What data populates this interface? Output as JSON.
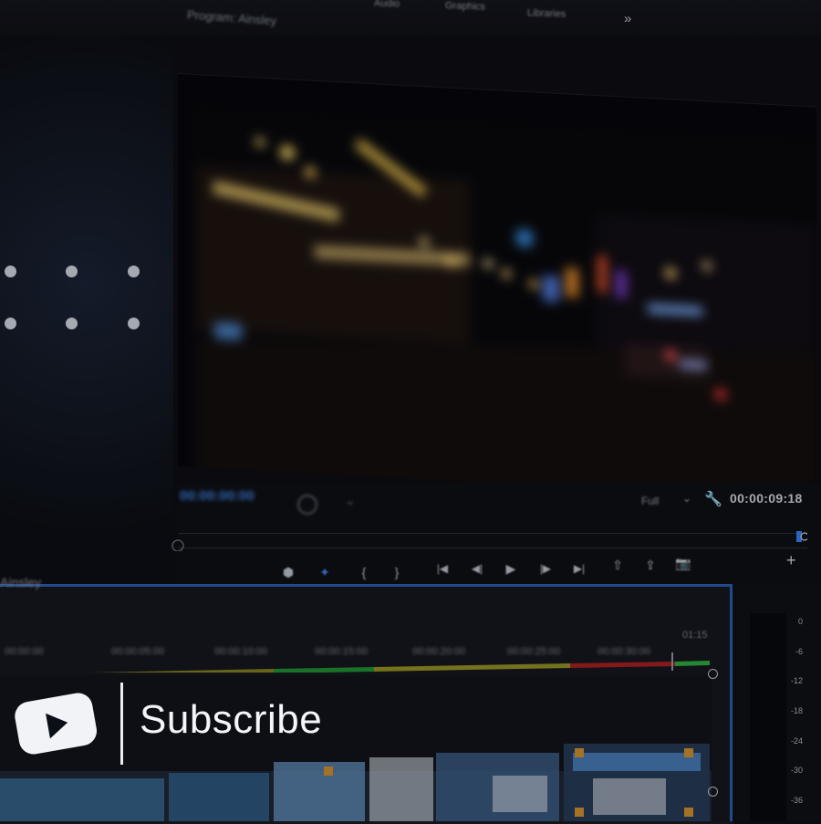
{
  "window": {
    "top_tabs": [
      "",
      "Audio",
      "Graphics",
      "Libraries"
    ],
    "more_tabs_icon": "double-chevron-right-icon",
    "panel_title": "Program: Ainsley"
  },
  "monitor": {
    "current_time_left": "00:00:00:00",
    "fit": "Full",
    "duration": "00:00:09:18"
  },
  "transport_icons": [
    "marker-icon",
    "ripple-icon",
    "mark-in-icon",
    "mark-out-icon",
    "go-to-in-icon",
    "step-back-icon",
    "play-icon",
    "step-forward-icon",
    "go-to-out-icon",
    "lift-icon",
    "extract-icon",
    "camera-icon"
  ],
  "add_button": "+",
  "timeline": {
    "sequence_name": "Ainsley",
    "ruler": [
      "00:00:00",
      "00:00:05:00",
      "00:00:10:00",
      "00:00:15:00",
      "00:00:20:00",
      "00:00:25:00",
      "00:00:30:00",
      "01:15"
    ]
  },
  "meter_labels": [
    "0",
    "-6",
    "-12",
    "-18",
    "-24",
    "-30",
    "-36"
  ],
  "overlay": {
    "subscribe_label": "Subscribe"
  },
  "colors": {
    "accent_blue": "#2a5aa8",
    "render_green": "#1f8a2e",
    "render_yellow": "#8d8a1e",
    "render_red": "#8a1c1c"
  }
}
